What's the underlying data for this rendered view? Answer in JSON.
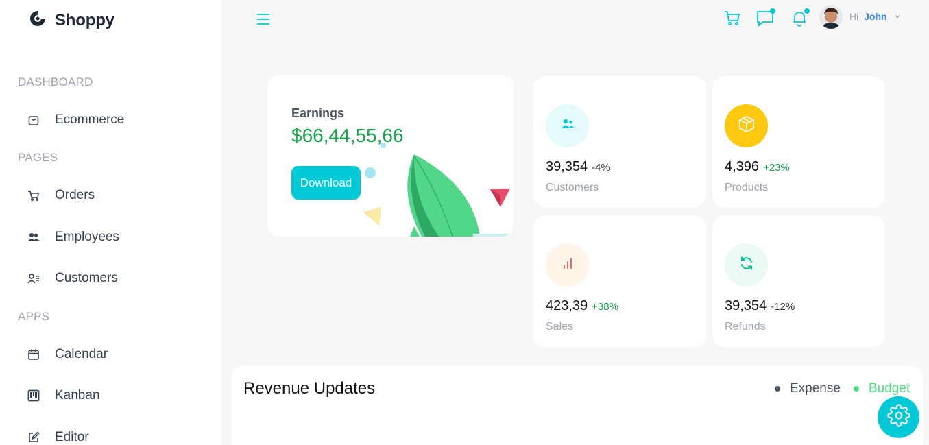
{
  "brand": {
    "name": "Shoppy"
  },
  "sidebar": {
    "sections": [
      {
        "title": "DASHBOARD"
      },
      {
        "title": "PAGES"
      },
      {
        "title": "APPS"
      }
    ],
    "items": [
      {
        "label": "Ecommerce",
        "icon": "shopping-bag-icon"
      },
      {
        "label": "Orders",
        "icon": "cart-icon"
      },
      {
        "label": "Employees",
        "icon": "employees-icon"
      },
      {
        "label": "Customers",
        "icon": "customers-icon"
      },
      {
        "label": "Calendar",
        "icon": "calendar-icon"
      },
      {
        "label": "Kanban",
        "icon": "kanban-icon"
      },
      {
        "label": "Editor",
        "icon": "editor-icon"
      }
    ]
  },
  "topbar": {
    "greeting": "Hi,",
    "user_name": "John"
  },
  "earnings": {
    "label": "Earnings",
    "value": "$66,44,55,66",
    "button_label": "Download"
  },
  "stats": [
    {
      "amount": "39,354",
      "percentage": "-4%",
      "title": "Customers",
      "icon": "customers-icon",
      "icon_color": "#03c9d7",
      "bg": "#e5fafb",
      "pct_color": "#333333"
    },
    {
      "amount": "4,396",
      "percentage": "+23%",
      "title": "Products",
      "icon": "box-icon",
      "icon_color": "#ffffff",
      "bg": "#fec90f",
      "pct_color": "#16a34a"
    },
    {
      "amount": "423,39",
      "percentage": "+38%",
      "title": "Sales",
      "icon": "bar-chart-icon",
      "icon_color": "#e46a76",
      "bg": "#fff4e8",
      "pct_color": "#16a34a"
    },
    {
      "amount": "39,354",
      "percentage": "-12%",
      "title": "Refunds",
      "icon": "refresh-icon",
      "icon_color": "#00c292",
      "bg": "#ebfaf2",
      "pct_color": "#333333"
    }
  ],
  "revenue": {
    "title": "Revenue Updates",
    "legend": [
      {
        "label": "Expense",
        "color": "#4b5563"
      },
      {
        "label": "Budget",
        "color": "#4ade80"
      }
    ]
  },
  "colors": {
    "accent": "#03c9d7",
    "positive": "#16a34a"
  }
}
